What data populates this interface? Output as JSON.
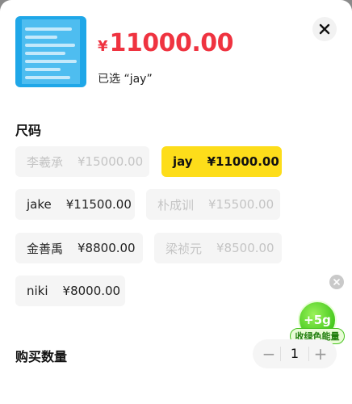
{
  "product": {
    "price_currency": "¥",
    "price_value": "11000.00",
    "selected_text": "已选 “jay”",
    "image_icon": "product-thumbnail"
  },
  "size_section": {
    "title": "尺码",
    "options": [
      {
        "name": "李羲承",
        "price": "¥15000.00",
        "state": "disabled"
      },
      {
        "name": "jay",
        "price": "¥11000.00",
        "state": "selected"
      },
      {
        "name": "jake",
        "price": "¥11500.00",
        "state": "normal"
      },
      {
        "name": "朴成训",
        "price": "¥15500.00",
        "state": "disabled"
      },
      {
        "name": "金善禹",
        "price": "¥8800.00",
        "state": "normal"
      },
      {
        "name": "梁祯元",
        "price": "¥8500.00",
        "state": "disabled"
      },
      {
        "name": "niki",
        "price": "¥8000.00",
        "state": "normal"
      }
    ]
  },
  "energy_badge": {
    "amount": "+5g",
    "label": "收绿色能量"
  },
  "quantity": {
    "title": "购买数量",
    "value": "1",
    "minus": "−",
    "plus": "+"
  },
  "colors": {
    "price_red": "#ef3340",
    "selected_yellow": "#fddd1a",
    "energy_green": "#46c91e"
  },
  "icons": [
    "close-icon",
    "minus-icon",
    "plus-icon",
    "dismiss-icon"
  ]
}
